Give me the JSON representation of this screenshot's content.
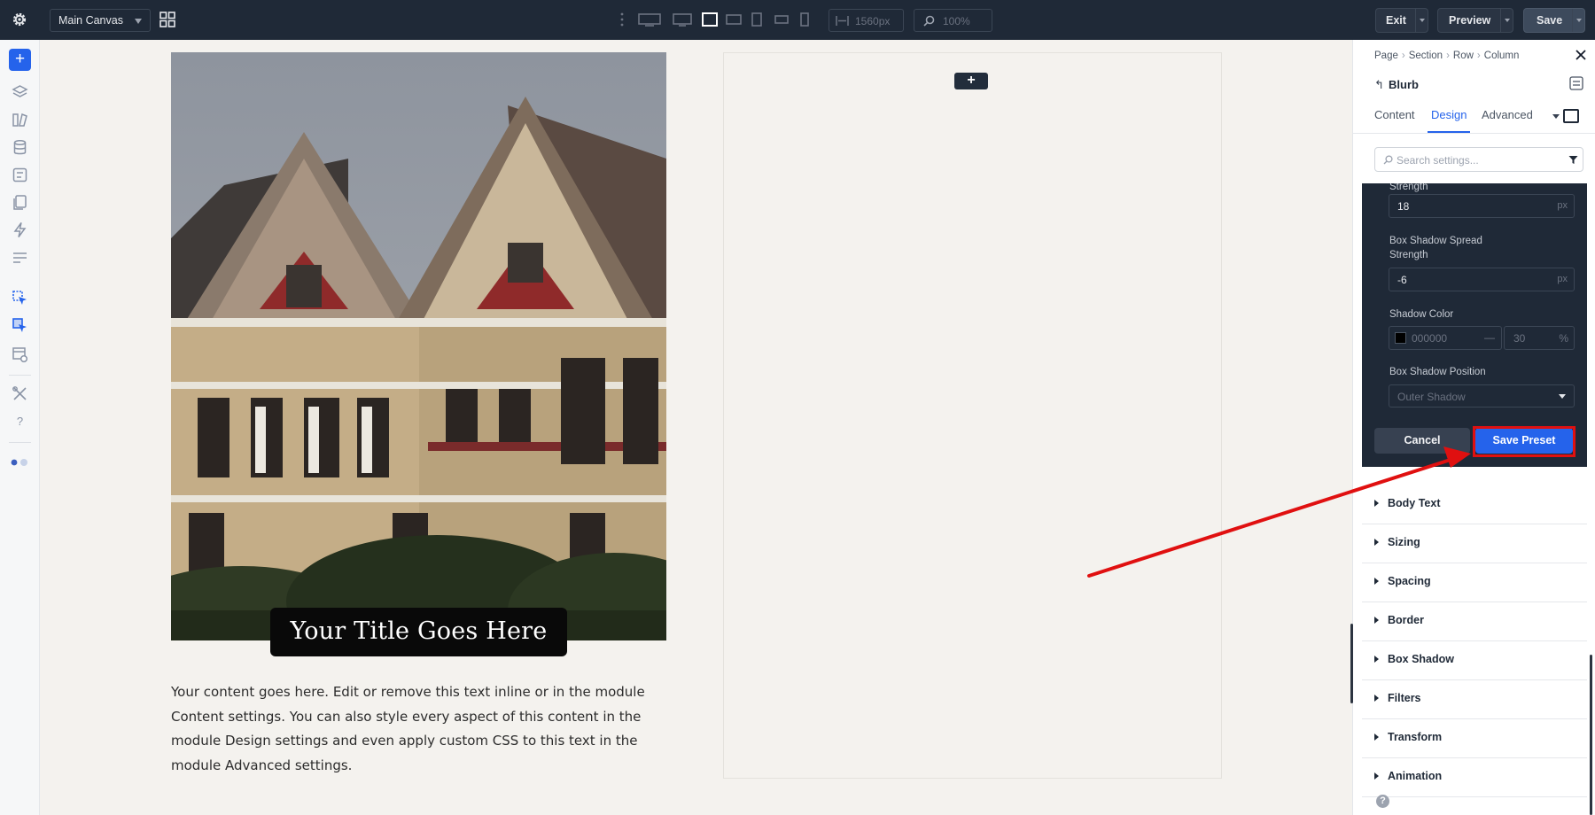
{
  "topbar": {
    "canvas_select": "Main Canvas",
    "width_value": "1560px",
    "zoom_value": "100%",
    "exit_label": "Exit",
    "preview_label": "Preview",
    "save_label": "Save"
  },
  "canvas": {
    "title": "Your Title Goes Here",
    "body_lines": [
      "Your content goes here. Edit or remove this text inline or in the module",
      "Content settings. You can also style every aspect of this content in the",
      "module Design settings and even apply custom CSS to this text in the",
      "module Advanced settings."
    ],
    "add_module": "+"
  },
  "panel": {
    "breadcrumb": [
      "Page",
      "Row",
      "Section",
      "Column"
    ],
    "module_name": "Blurb",
    "tabs": [
      "Content",
      "Design",
      "Advanced"
    ],
    "active_tab": "Design",
    "search_placeholder": "Search settings...",
    "preset_editor": {
      "strength_label": "Strength",
      "blur_value": "18",
      "blur_unit": "px",
      "spread_label": "Box Shadow Spread Strength",
      "spread_value": "-6",
      "spread_unit": "px",
      "color_label": "Shadow Color",
      "color_value": "000000",
      "color_dash": "—",
      "opacity_value": "30",
      "opacity_unit": "%",
      "position_label": "Box Shadow Position",
      "position_value": "Outer Shadow",
      "cancel_label": "Cancel",
      "save_preset_label": "Save Preset"
    },
    "groups": [
      "Body Text",
      "Sizing",
      "Spacing",
      "Border",
      "Box Shadow",
      "Filters",
      "Transform",
      "Animation"
    ],
    "help_icon": "?"
  },
  "colors": {
    "accent": "#2563eb",
    "topbar": "#1f2937",
    "highlight": "#e01010"
  }
}
